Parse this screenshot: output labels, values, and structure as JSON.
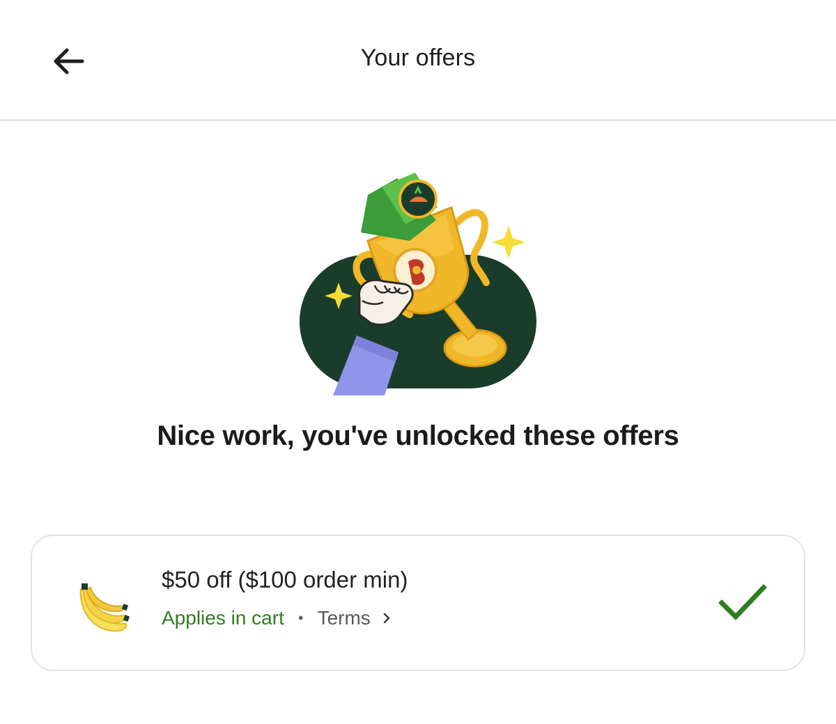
{
  "header": {
    "title": "Your offers",
    "back_icon": "arrow-left-icon"
  },
  "hero": {
    "illustration": "trophy-illustration",
    "headline": "Nice work, you've unlocked these offers"
  },
  "offers": [
    {
      "icon": "banana-icon",
      "title": "$50 off ($100 order min)",
      "applies_label": "Applies in cart",
      "separator": "•",
      "terms_label": "Terms",
      "status_icon": "checkmark-icon"
    }
  ],
  "colors": {
    "accent_green": "#2e7d1f",
    "illustration_dark_green": "#1a3d2b",
    "trophy_gold": "#f0b829",
    "divider": "#e6e6e6"
  }
}
